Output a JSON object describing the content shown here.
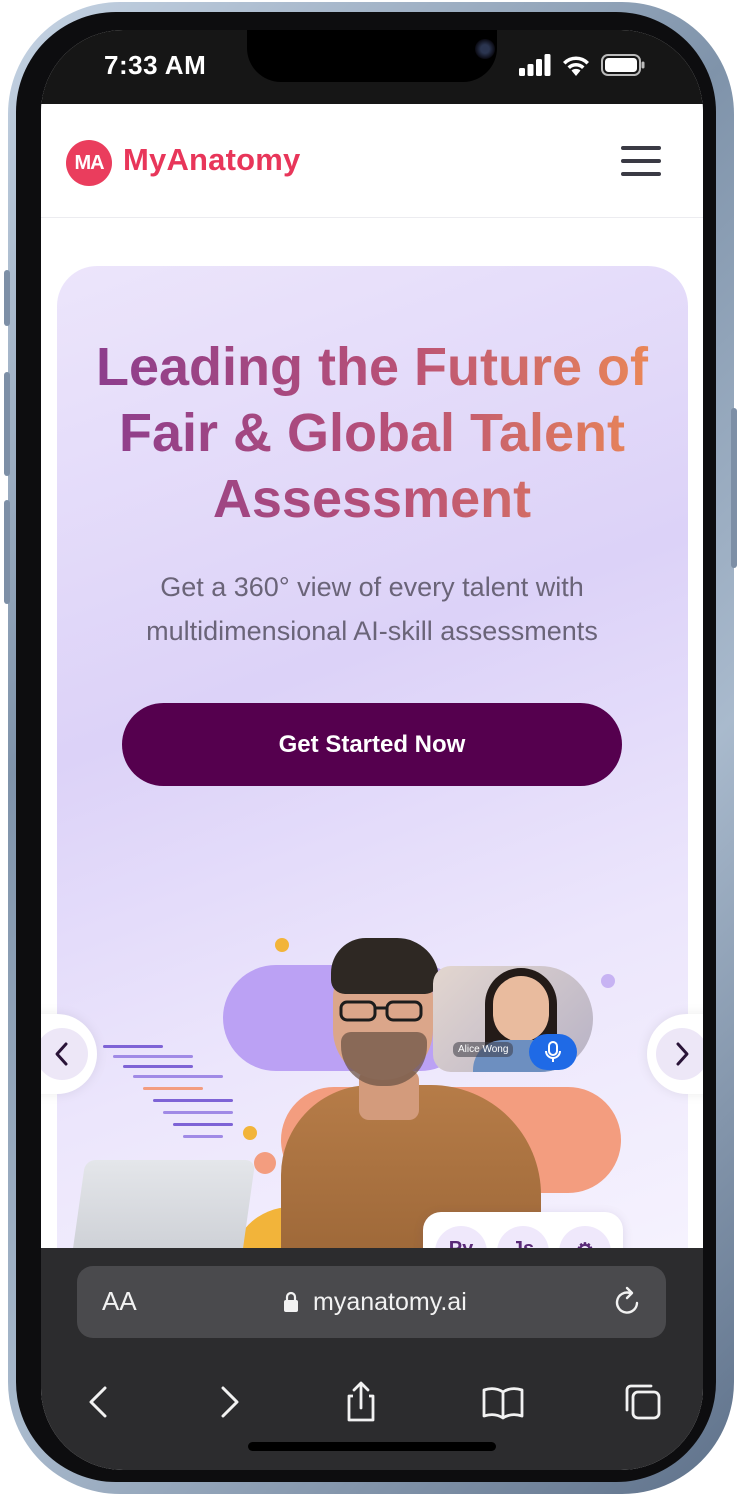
{
  "status_bar": {
    "time": "7:33 AM",
    "icons": [
      "cellular-signal-icon",
      "wifi-icon",
      "battery-icon"
    ]
  },
  "header": {
    "logo_badge": "MA",
    "brand": "MyAnatomy",
    "menu_icon": "hamburger-menu-icon"
  },
  "hero": {
    "title": "Leading the Future of Fair & Global Talent Assessment",
    "subtitle": "Get a 360° view of every talent with multidimensional AI-skill assessments",
    "cta_label": "Get Started Now"
  },
  "illustration": {
    "video_caller_name": "Alice Wong",
    "skill_chips": [
      "Py",
      "Js",
      "⚙"
    ]
  },
  "carousel": {
    "prev_icon": "chevron-left-icon",
    "next_icon": "chevron-right-icon"
  },
  "browser": {
    "text_size_label": "AA",
    "url": "myanatomy.ai",
    "toolbar_icons": [
      "back-icon",
      "forward-icon",
      "share-icon",
      "bookmarks-icon",
      "tabs-icon"
    ]
  },
  "colors": {
    "brand": "#e8365a",
    "cta": "#55004e",
    "hero_bg": "#dcd2f8"
  }
}
